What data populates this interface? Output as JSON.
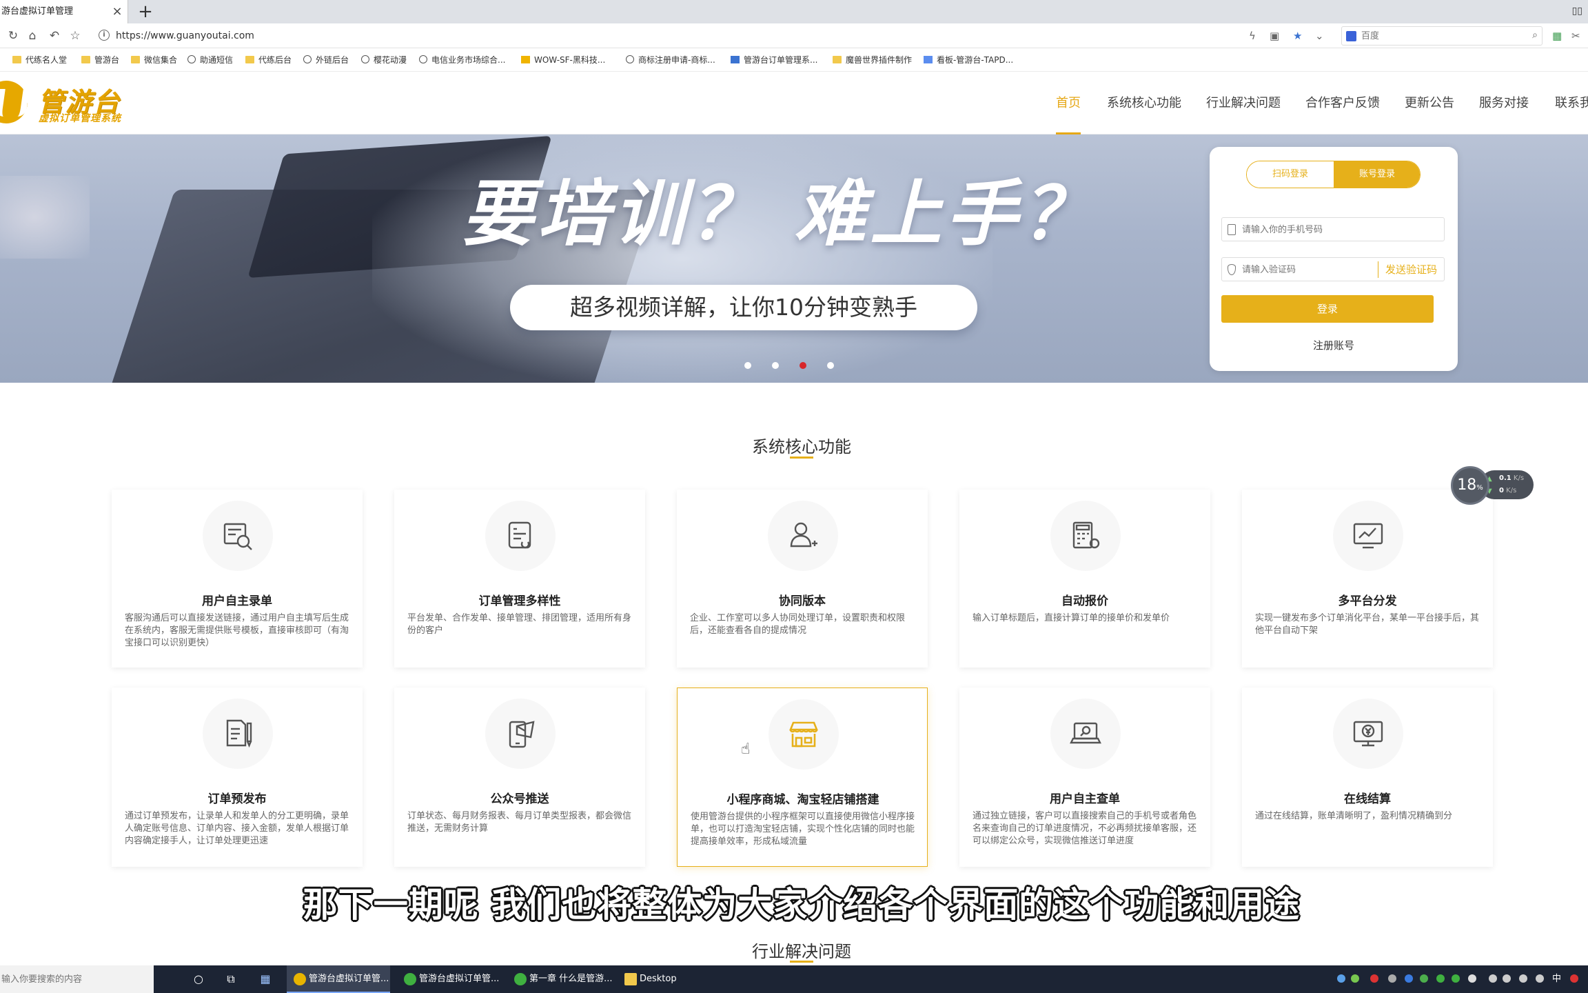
{
  "browser": {
    "tab_title": "游台虚拟订单管理",
    "tab_close": "×",
    "new_tab": "+",
    "url": "https://www.guanyoutai.com",
    "search_placeholder": "百度",
    "bookmarks": [
      "代练名人堂",
      "管游台",
      "微信集合",
      "助通短信",
      "代练后台",
      "外链后台",
      "樱花动漫",
      "电信业务市场综合...",
      "WOW-SF-黑科技...",
      "商标注册申请-商标...",
      "管游台订单管理系...",
      "魔兽世界插件制作",
      "看板-管游台-TAPD..."
    ]
  },
  "site": {
    "logo_title": "管游台",
    "logo_sub": "虚拟订单管理系统",
    "nav": [
      "首页",
      "系统核心功能",
      "行业解决问题",
      "合作客户反馈",
      "更新公告",
      "服务对接",
      "联系我"
    ],
    "active_nav": "首页"
  },
  "hero": {
    "title": "要培训？ 难上手？",
    "subtitle": "超多视频详解，让你10分钟变熟手",
    "slide_count": 4,
    "active_slide": 3
  },
  "login": {
    "tab_qr": "扫码登录",
    "tab_account": "账号登录",
    "phone_placeholder": "请输入你的手机号码",
    "code_placeholder": "请输入验证码",
    "send_code": "发送验证码",
    "login_button": "登录",
    "register_link": "注册账号"
  },
  "core": {
    "title": "系统核心功能",
    "features": [
      {
        "title": "用户自主录单",
        "desc": "客服沟通后可以直接发送链接，通过用户自主填写后生成在系统内，客服无需提供账号模板，直接审核即可（有淘宝接口可以识别更快）",
        "icon": "form-search-icon"
      },
      {
        "title": "订单管理多样性",
        "desc": "平台发单、合作发单、接单管理、排团管理，适用所有身份的客户",
        "icon": "order-list-icon"
      },
      {
        "title": "协同版本",
        "desc": "企业、工作室可以多人协同处理订单，设置职责和权限后，还能查看各自的提成情况",
        "icon": "users-add-icon"
      },
      {
        "title": "自动报价",
        "desc": "输入订单标题后，直接计算订单的接单价和发单价",
        "icon": "calculator-icon"
      },
      {
        "title": "多平台分发",
        "desc": "实现一键发布多个订单消化平台，某单一平台接手后，其他平台自动下架",
        "icon": "chart-monitor-icon"
      },
      {
        "title": "订单预发布",
        "desc": "通过订单预发布，让录单人和发单人的分工更明确，录单人确定账号信息、订单内容、接入金额，发单人根据订单内容确定接手人，让订单处理更迅速",
        "icon": "document-pen-icon"
      },
      {
        "title": "公众号推送",
        "desc": "订单状态、每月财务报表、每月订单类型报表，都会微信推送，无需财务计算",
        "icon": "phone-message-icon"
      },
      {
        "title": "小程序商城、淘宝轻店铺搭建",
        "desc": "使用管游台提供的小程序框架可以直接使用微信小程序接单，也可以打造淘宝轻店铺，实现个性化店铺的同时也能提高接单效率，形成私域流量",
        "icon": "store-icon"
      },
      {
        "title": "用户自主查单",
        "desc": "通过独立链接，客户可以直接搜索自己的手机号或者角色名来查询自己的订单进度情况，不必再频扰接单客服，还可以绑定公众号，实现微信推送订单进度",
        "icon": "laptop-search-icon"
      },
      {
        "title": "在线结算",
        "desc": "通过在线结算，账单清晰明了，盈利情况精确到分",
        "icon": "monitor-yuan-icon"
      }
    ]
  },
  "industry": {
    "title": "行业解决问题"
  },
  "speed_widget": {
    "percent": "18",
    "percent_unit": "%",
    "up": "0.1",
    "down": "0",
    "unit": "K/s"
  },
  "caption": "那下一期呢  我们也将整体为大家介绍各个界面的这个功能和用途",
  "taskbar": {
    "search_placeholder": "输入你要搜索的内容",
    "apps": [
      "管游台虚拟订单管...",
      "管游台虚拟订单管...",
      "第一章 什么是管游...",
      "Desktop"
    ],
    "ime": "中"
  },
  "colors": {
    "accent": "#e6b01a",
    "active_dot": "#d7262a",
    "taskbar": "#1c2434"
  }
}
